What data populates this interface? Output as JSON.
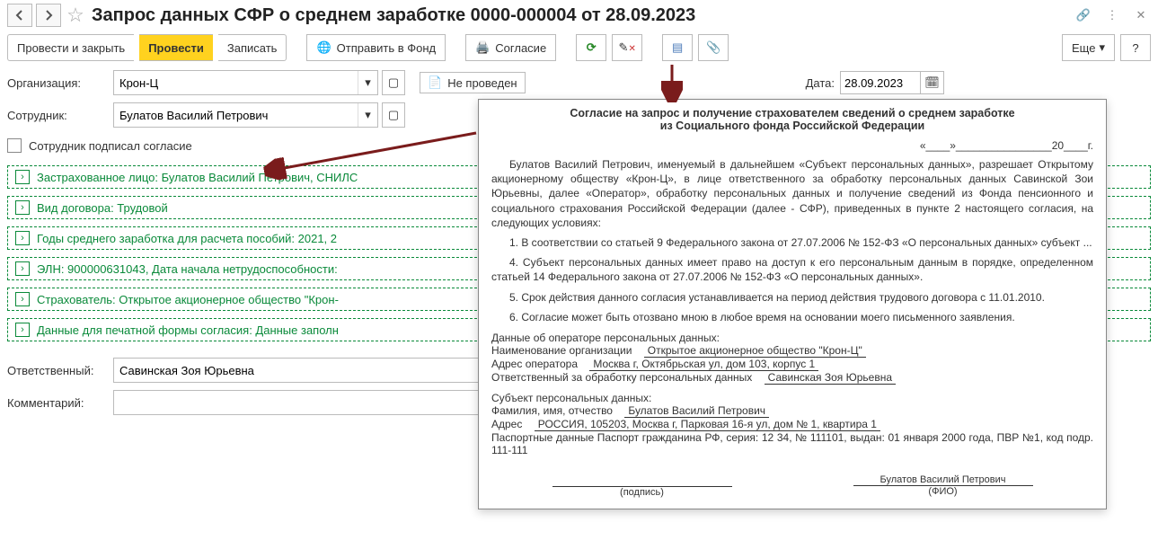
{
  "header": {
    "title": "Запрос данных СФР о среднем заработке 0000-000004 от 28.09.2023"
  },
  "toolbar": {
    "post_close": "Провести и закрыть",
    "post": "Провести",
    "write": "Записать",
    "send": "Отправить в Фонд",
    "consent": "Согласие",
    "more": "Еще",
    "help": "?"
  },
  "form": {
    "org_label": "Организация:",
    "org_value": "Крон-Ц",
    "employee_label": "Сотрудник:",
    "employee_value": "Булатов Василий Петрович",
    "status_label": "Не проведен",
    "date_label": "Дата:",
    "date_value": "28.09.2023",
    "consent_signed_label": "Сотрудник подписал согласие"
  },
  "sections": {
    "insured": "Застрахованное лицо: Булатов Василий Петрович, СНИЛС",
    "contract": "Вид договора: Трудовой",
    "years": "Годы среднего заработка для расчета пособий: 2021, 2",
    "eln": "ЭЛН: 900000631043, Дата начала нетрудоспособности:",
    "insurer": "Страхователь: Открытое акционерное общество \"Крон-",
    "print_data": "Данные для печатной формы согласия: Данные заполн"
  },
  "footer": {
    "resp_label": "Ответственный:",
    "resp_value": "Савинская Зоя Юрьевна",
    "comment_label": "Комментарий:",
    "comment_value": ""
  },
  "doc": {
    "title1": "Согласие на запрос и получение страхователем сведений о среднем заработке",
    "title2": "из Социального фонда Российской Федерации",
    "dateline": "«____»________________20____г.",
    "p1": "Булатов Василий Петрович, именуемый в дальнейшем «Субъект персональных данных», разрешает Открытому акционерному обществу «Крон-Ц», в лице ответственного за обработку персональных данных Савинской Зои Юрьевны, далее «Оператор», обработку персональных данных и получение сведений из Фонда пенсионного и социального страхования Российской Федерации (далее - СФР), приведенных в пункте 2 настоящего согласия, на следующих условиях:",
    "p2": "1. В соответствии со статьей 9 Федерального закона от 27.07.2006 № 152-ФЗ «О персональных данных» субъект ...",
    "p3": "4. Субъект персональных данных имеет право на доступ к его персональным данным в порядке, определенном статьей 14 Федерального закона от 27.07.2006 № 152-ФЗ «О персональных данных».",
    "p4": "5. Срок действия данного согласия устанавливается на период действия трудового договора  с 11.01.2010.",
    "p5": "6. Согласие может быть отозвано мною в любое время на основании моего письменного заявления.",
    "op_header": "Данные об операторе персональных данных:",
    "op_name_l": "Наименование организации",
    "op_name_v": "Открытое акционерное общество \"Крон-Ц\"",
    "op_addr_l": "Адрес оператора",
    "op_addr_v": "Москва г, Октябрьская ул, дом 103, корпус 1",
    "op_resp_l": "Ответственный за обработку персональных данных",
    "op_resp_v": "Савинская Зоя Юрьевна",
    "subj_header": "Субъект персональных данных:",
    "subj_fio_l": "Фамилия, имя, отчество",
    "subj_fio_v": "Булатов Василий Петрович",
    "subj_addr_l": "Адрес",
    "subj_addr_v": "РОССИЯ, 105203, Москва г, Парковая 16-я ул, дом № 1, квартира 1",
    "subj_pass": "Паспортные данные Паспорт гражданина РФ, серия: 12 34, № 111101, выдан: 01 января 2000 года, ПВР №1, код подр. 111-111",
    "sign_name": "Булатов Василий Петрович",
    "sign_podpis": "(подпись)",
    "sign_fio": "(ФИО)"
  }
}
